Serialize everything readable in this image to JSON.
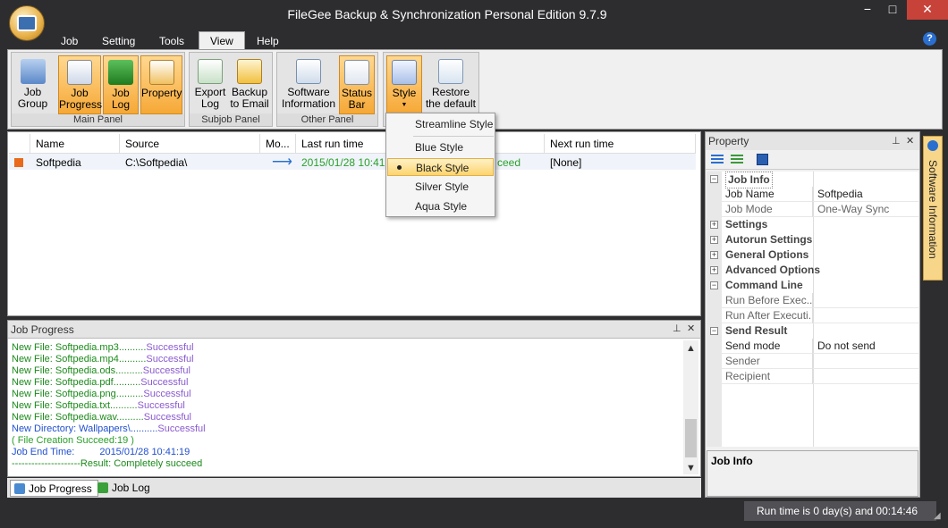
{
  "window": {
    "title": "FileGee Backup & Synchronization Personal Edition 9.7.9",
    "min": "−",
    "max": "□",
    "close": "✕"
  },
  "menu": [
    "Job",
    "Setting",
    "Tools",
    "View",
    "Help"
  ],
  "help": "?",
  "ribbon": {
    "groups": [
      {
        "label": "Main Panel",
        "buttons": [
          "Job\nGroup",
          "Job\nProgress",
          "Job\nLog",
          "Property"
        ]
      },
      {
        "label": "Subjob Panel",
        "buttons": [
          "Export\nLog",
          "Backup\nto Email"
        ]
      },
      {
        "label": "Other Panel",
        "buttons": [
          "Software\nInformation",
          "Status\nBar"
        ]
      },
      {
        "label": "",
        "buttons": [
          "Style",
          "Restore\nthe default"
        ]
      }
    ]
  },
  "style_menu": {
    "items": [
      "Streamline Style",
      "Blue Style",
      "Black Style",
      "Silver Style",
      "Aqua Style"
    ],
    "selected": "Black Style"
  },
  "table": {
    "columns": [
      "Name",
      "Source",
      "Mo...",
      "Last run time",
      "Next run time"
    ],
    "rows": [
      {
        "name": "Softpedia",
        "source": "C:\\Softpedia\\",
        "mode_icon": "arrow-right-icon",
        "last_run": "2015/01/28 10:41:1",
        "status": "ceed",
        "next_run": "[None]"
      }
    ]
  },
  "job_progress": {
    "title": "Job Progress",
    "lines": [
      {
        "a": "New File: Softpedia.mp3..........",
        "b": "Successful"
      },
      {
        "a": "New File: Softpedia.mp4..........",
        "b": "Successful"
      },
      {
        "a": "New File: Softpedia.ods..........",
        "b": "Successful"
      },
      {
        "a": "New File: Softpedia.pdf..........",
        "b": "Successful"
      },
      {
        "a": "New File: Softpedia.png..........",
        "b": "Successful"
      },
      {
        "a": "New File: Softpedia.txt..........",
        "b": "Successful"
      },
      {
        "a": "New File: Softpedia.wav..........",
        "b": "Successful"
      },
      {
        "a": "New Directory: Wallpapers\\..........",
        "b": "Successful"
      },
      {
        "a": "( File Creation Succeed:19 )",
        "b": ""
      },
      {
        "a": "Job End Time:",
        "b": "2015/01/28 10:41:19"
      },
      {
        "a": "---------------------Result: Completely succeed",
        "b": ""
      }
    ]
  },
  "bottom_tabs": [
    "Job Progress",
    "Job Log"
  ],
  "property": {
    "title": "Property",
    "categories": {
      "job_info": "Job Info",
      "settings": "Settings",
      "autorun": "Autorun Settings",
      "general": "General Options",
      "advanced": "Advanced Options",
      "command": "Command Line",
      "send": "Send Result"
    },
    "rows": {
      "job_name": [
        "Job Name",
        "Softpedia"
      ],
      "job_mode": [
        "Job Mode",
        "One-Way Sync"
      ],
      "run_before": [
        "Run Before Exec...",
        ""
      ],
      "run_after": [
        "Run After Executi...",
        ""
      ],
      "send_mode": [
        "Send mode",
        "Do not send"
      ],
      "sender": [
        "Sender",
        ""
      ],
      "recipient": [
        "Recipient",
        ""
      ]
    },
    "description": "Job Info"
  },
  "side_tab": "Software Information",
  "status": "Run time is 0 day(s) and 00:14:46"
}
